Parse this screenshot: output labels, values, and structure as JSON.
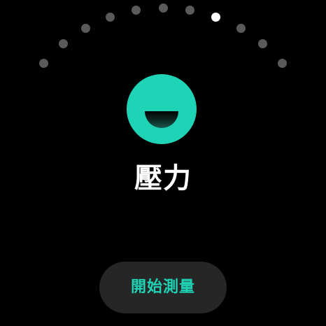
{
  "colors": {
    "background": "#000000",
    "accent": "#1fd3b7",
    "dot_inactive": "#5a5a5a",
    "dot_active": "#ffffff",
    "button_bg": "#262626"
  },
  "pager": {
    "total": 11,
    "active_index": 7
  },
  "icon": {
    "name": "smiling-face-icon"
  },
  "title": "壓力",
  "start_button": {
    "label": "開始測量"
  }
}
